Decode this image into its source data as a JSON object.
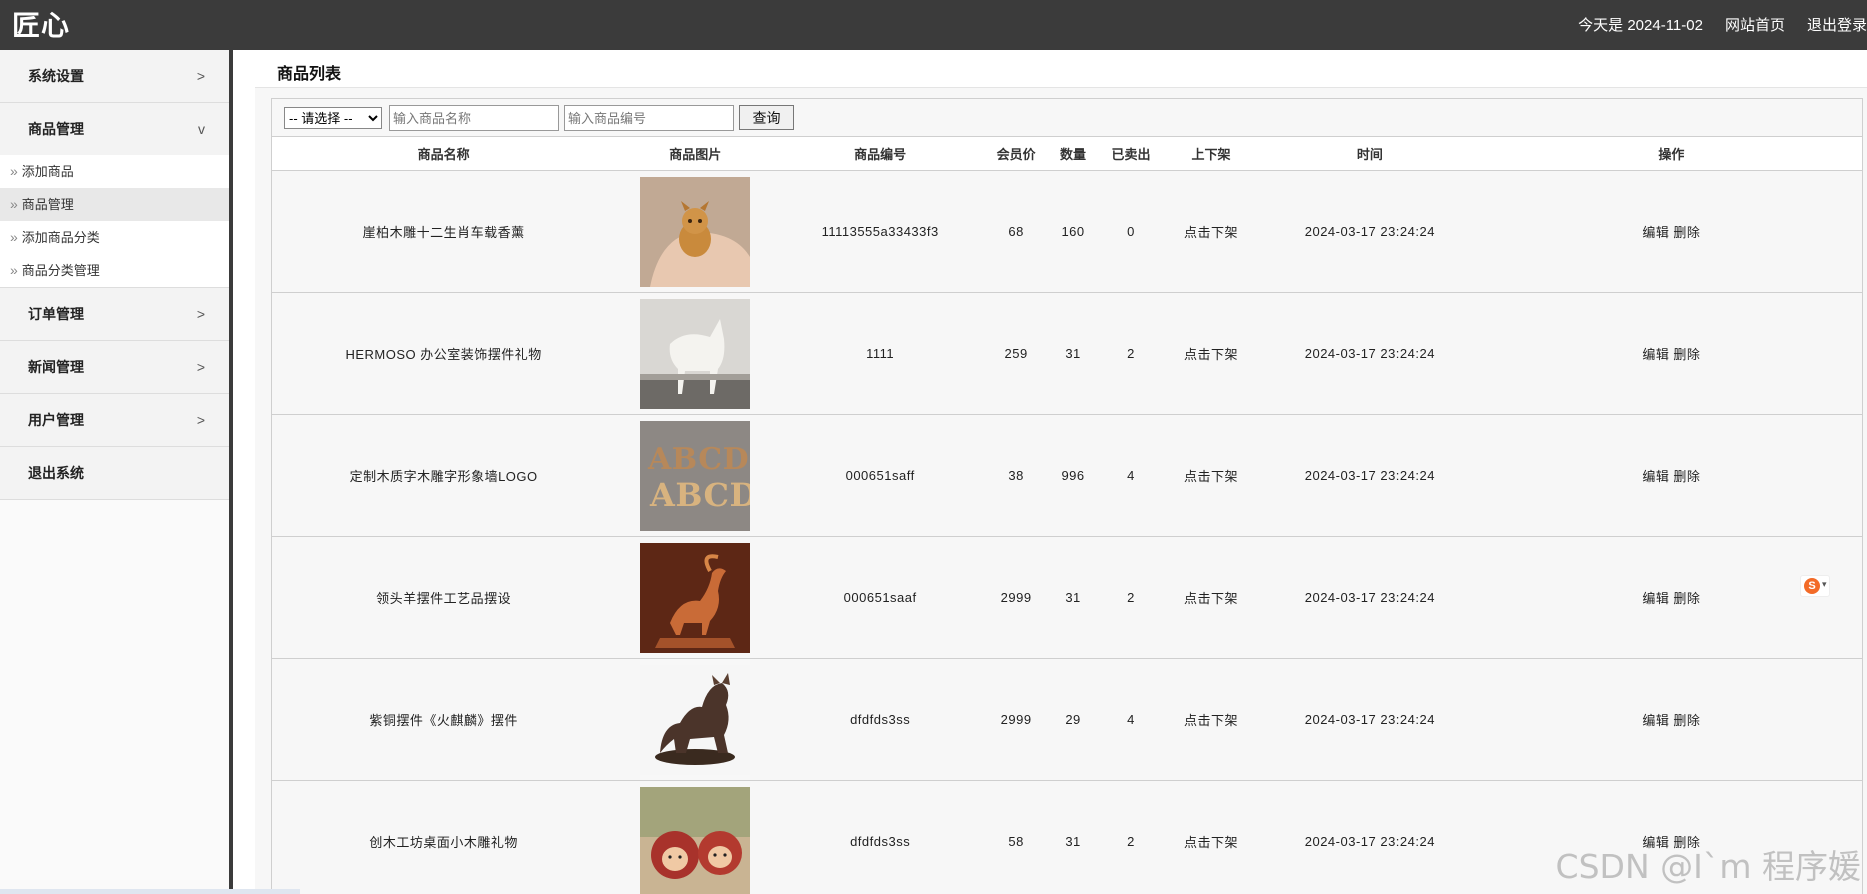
{
  "header": {
    "logo": "匠心",
    "date_label": "今天是 2024-11-02",
    "home_link": "网站首页",
    "logout_link": "退出登录"
  },
  "sidebar": {
    "groups": [
      {
        "label": "系统设置",
        "arrow": ">"
      },
      {
        "label": "商品管理",
        "arrow": "v",
        "items": [
          "添加商品",
          "商品管理",
          "添加商品分类",
          "商品分类管理"
        ]
      },
      {
        "label": "订单管理",
        "arrow": ">"
      },
      {
        "label": "新闻管理",
        "arrow": ">"
      },
      {
        "label": "用户管理",
        "arrow": ">"
      },
      {
        "label": "退出系统"
      }
    ],
    "active_item": "商品管理",
    "item_prefix": "»"
  },
  "main": {
    "title": "商品列表",
    "toolbar": {
      "select_value": "-- 请选择 --",
      "name_placeholder": "输入商品名称",
      "code_placeholder": "输入商品编号",
      "query_label": "查询"
    },
    "columns": [
      "商品名称",
      "商品图片",
      "商品编号",
      "会员价",
      "数量",
      "已卖出",
      "上下架",
      "时间",
      "操作"
    ],
    "rows": [
      {
        "name": "崖柏木雕十二生肖车载香薰",
        "image": "carved-dragon-in-hand",
        "code": "11113555a33433f3",
        "price": "68",
        "qty": "160",
        "sold": "0",
        "status": "点击下架",
        "time": "2024-03-17 23:24:24",
        "edit": "编辑",
        "delete": "删除"
      },
      {
        "name": "HERMOSO 办公室装饰摆件礼物",
        "image": "white-horse-figurine",
        "code": "1111",
        "price": "259",
        "qty": "31",
        "sold": "2",
        "status": "点击下架",
        "time": "2024-03-17 23:24:24",
        "edit": "编辑",
        "delete": "删除"
      },
      {
        "name": "定制木质字木雕字形象墙LOGO",
        "image": "wooden-abcd-letters",
        "code": "000651saff",
        "price": "38",
        "qty": "996",
        "sold": "4",
        "status": "点击下架",
        "time": "2024-03-17 23:24:24",
        "edit": "编辑",
        "delete": "删除"
      },
      {
        "name": "领头羊摆件工艺品摆设",
        "image": "wooden-goat-carving",
        "code": "000651saaf",
        "price": "2999",
        "qty": "31",
        "sold": "2",
        "status": "点击下架",
        "time": "2024-03-17 23:24:24",
        "edit": "编辑",
        "delete": "删除"
      },
      {
        "name": "紫铜摆件《火麒麟》摆件",
        "image": "bronze-qilin-statue",
        "code": "dfdfds3ss",
        "price": "2999",
        "qty": "29",
        "sold": "4",
        "status": "点击下架",
        "time": "2024-03-17 23:24:24",
        "edit": "编辑",
        "delete": "删除"
      },
      {
        "name": "创木工坊桌面小木雕礼物",
        "image": "wooden-apple-figures",
        "code": "dfdfds3ss",
        "price": "58",
        "qty": "31",
        "sold": "2",
        "status": "点击下架",
        "time": "2024-03-17 23:24:24",
        "edit": "编辑",
        "delete": "删除"
      }
    ]
  },
  "overlay": {
    "badge_letter": "S",
    "watermark": "CSDN @I`m 程序媛"
  }
}
